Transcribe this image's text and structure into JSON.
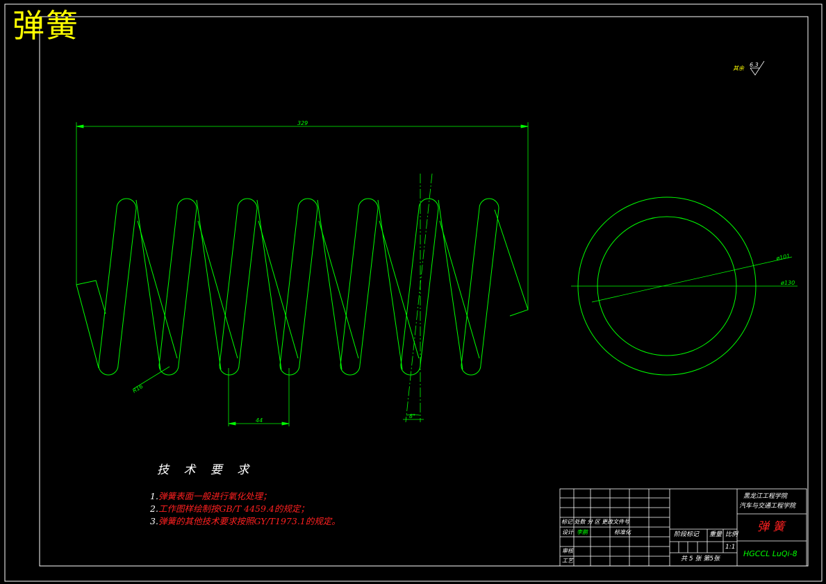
{
  "title": "弹簧",
  "roughness": {
    "label": "其余",
    "value": "6.3"
  },
  "dimensions": {
    "length": "329",
    "pitch": "44",
    "wire_radius": "R16",
    "angle": "8°",
    "inner_diameter": "ø101",
    "outer_diameter": "ø130"
  },
  "tech_requirements": {
    "title": "技 术 要 求",
    "items": [
      {
        "num": "1.",
        "text": "弹簧表面一般进行氧化处理；"
      },
      {
        "num": "2.",
        "text": "工作图样绘制按GB/T 4459.4的规定；"
      },
      {
        "num": "3.",
        "text": "弹簧的其他技术要求按照GY/T1973.1的规定。"
      }
    ]
  },
  "title_block": {
    "school_line1": "黑龙江工程学院",
    "school_line2": "汽车与交通工程学院",
    "part_name": "弹 簧",
    "drawing_no": "HGCCL LuQi-8",
    "scale_label": "比例",
    "scale_value": "1:1",
    "stage_label": "阶段标记",
    "weight_label": "重量",
    "sheets": "共 5 张  第5张",
    "revision_labels": "标记 处数 分  区 更改文件号",
    "designer_label": "设计",
    "designer_name": "李鹏",
    "standard_label": "标准化",
    "review_label": "审核",
    "process_label": "工艺"
  },
  "colors": {
    "background": "#000000",
    "lines": "#00ff00",
    "frame": "#ffffff",
    "title": "#ffff00",
    "red_text": "#ff2020"
  }
}
